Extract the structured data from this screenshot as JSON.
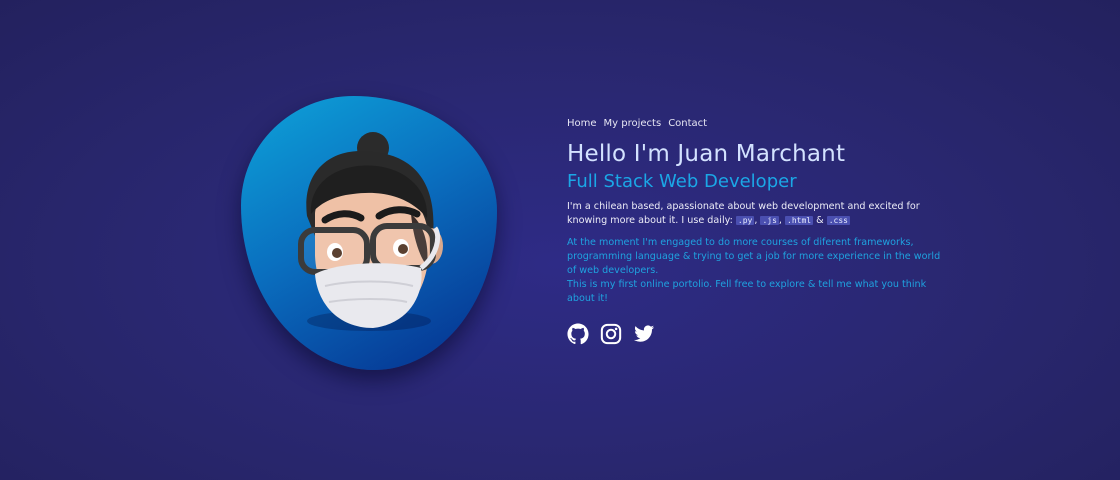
{
  "nav": {
    "items": [
      {
        "label": "Home"
      },
      {
        "label": "My projects"
      },
      {
        "label": "Contact"
      }
    ]
  },
  "hero": {
    "title": "Hello I'm Juan Marchant",
    "subtitle": "Full Stack Web Developer",
    "intro_text": "I'm a chilean based, apassionate about web development and excited for knowing more about it. I use daily:",
    "tech": [
      ".py",
      ".js",
      ".html",
      ".css"
    ],
    "blurb_line1": "At the moment I'm engaged to do more courses of diferent frameworks, programming language & trying to get a job for more experience in the world of web developers.",
    "blurb_line2": "This is my first online portolio. Fell free to explore & tell me what you think about it!"
  },
  "social": [
    "github-icon",
    "instagram-icon",
    "twitter-icon"
  ],
  "colors": {
    "background": "#29276f",
    "accent": "#1ba7e6",
    "title": "#d3e2ff",
    "code_bg": "#4a4fb0"
  }
}
